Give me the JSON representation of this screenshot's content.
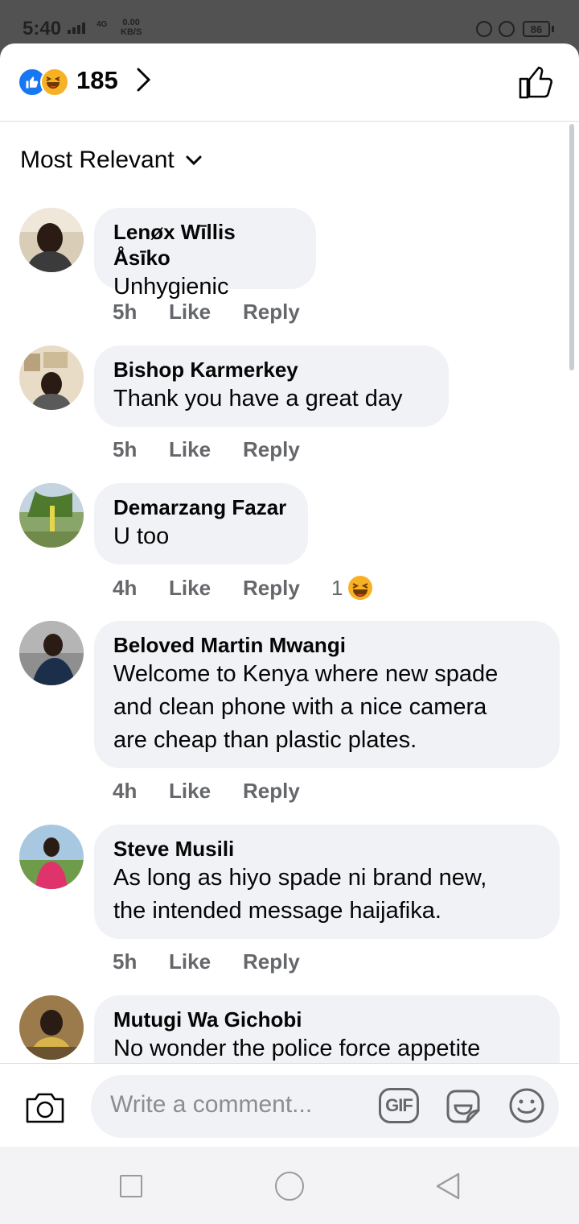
{
  "status_bar": {
    "time": "5:40",
    "network": "4G",
    "speed_value": "0.00",
    "speed_unit": "KB/S",
    "battery": "86"
  },
  "header": {
    "reaction_count": "185",
    "reactions": [
      "like-reaction-icon",
      "haha-reaction-icon"
    ]
  },
  "sort": {
    "label": "Most Relevant"
  },
  "comments": [
    {
      "name": "Lenøx Wīllis Åsīko",
      "text": [
        "Unhygienic"
      ],
      "time": "5h",
      "like": "Like",
      "reply": "Reply",
      "reaction_count": ""
    },
    {
      "name": "Bishop Karmerkey",
      "text": [
        "Thank you have a great day"
      ],
      "time": "5h",
      "like": "Like",
      "reply": "Reply",
      "reaction_count": ""
    },
    {
      "name": "Demarzang Fazar",
      "text": [
        "U too"
      ],
      "time": "4h",
      "like": "Like",
      "reply": "Reply",
      "reaction_count": "1"
    },
    {
      "name": "Beloved Martin Mwangi",
      "text": [
        "Welcome to Kenya where new spade",
        "and clean phone with a nice camera",
        "are cheap than plastic plates."
      ],
      "time": "4h",
      "like": "Like",
      "reply": "Reply",
      "reaction_count": ""
    },
    {
      "name": "Steve Musili",
      "text": [
        "As long as hiyo spade ni brand new,",
        "the intended message haijafika."
      ],
      "time": "5h",
      "like": "Like",
      "reply": "Reply",
      "reaction_count": ""
    },
    {
      "name": "Mutugi Wa Gichobi",
      "text": [
        "No wonder the police force appetite"
      ],
      "time": "",
      "like": "",
      "reply": "",
      "reaction_count": ""
    }
  ],
  "composer": {
    "placeholder": "Write a comment...",
    "gif_label": "GIF"
  },
  "colors": {
    "accent_blue": "#1877f2",
    "bubble_bg": "#f0f2f5",
    "secondary_text": "#65676b",
    "haha_yellow": "#f7b125"
  }
}
